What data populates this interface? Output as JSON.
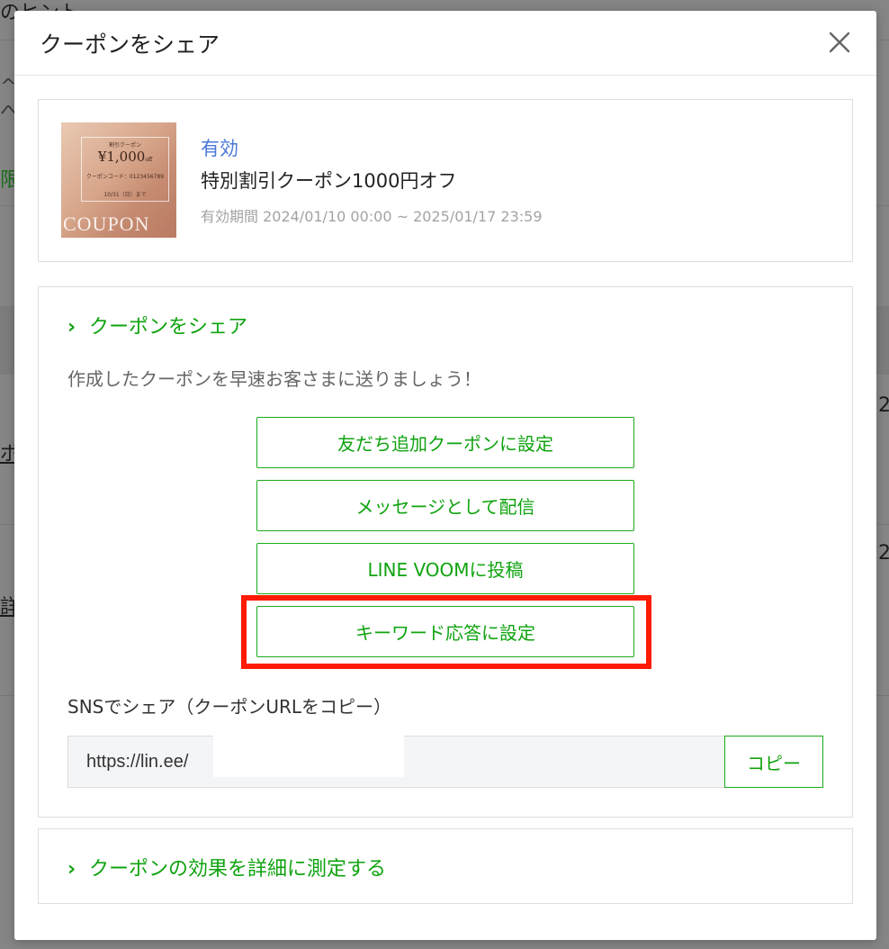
{
  "background": {
    "fragments": [
      "のヒント",
      "ー",
      "^",
      "へ",
      "限切",
      "ポ",
      "詳",
      "2",
      "2"
    ]
  },
  "modal": {
    "title": "クーポンをシェア",
    "close_icon": "close-icon"
  },
  "coupon": {
    "thumbnail": {
      "top_text": "割引クーポン",
      "price": "¥1,000",
      "price_suffix": "off",
      "code_text": "クーポンコード：0123456789",
      "date_text": "10/31（日）まで",
      "watermark": "COUPON"
    },
    "status": "有効",
    "name": "特別割引クーポン1000円オフ",
    "validity": "有効期間 2024/01/10 00:00 ~ 2025/01/17 23:59"
  },
  "share": {
    "heading": "クーポンをシェア",
    "description": "作成したクーポンを早速お客さまに送りましょう！",
    "buttons": [
      "友だち追加クーポンに設定",
      "メッセージとして配信",
      "LINE VOOMに投稿",
      "キーワード応答に設定"
    ],
    "sns_label": "SNSでシェア（クーポンURLをコピー）",
    "url_value": "https://lin.ee/",
    "copy_label": "コピー"
  },
  "measure": {
    "heading": "クーポンの効果を詳細に測定する"
  },
  "colors": {
    "accent_green": "#0fa30f",
    "status_blue": "#4a78d8",
    "highlight_red": "#ff1a00"
  }
}
